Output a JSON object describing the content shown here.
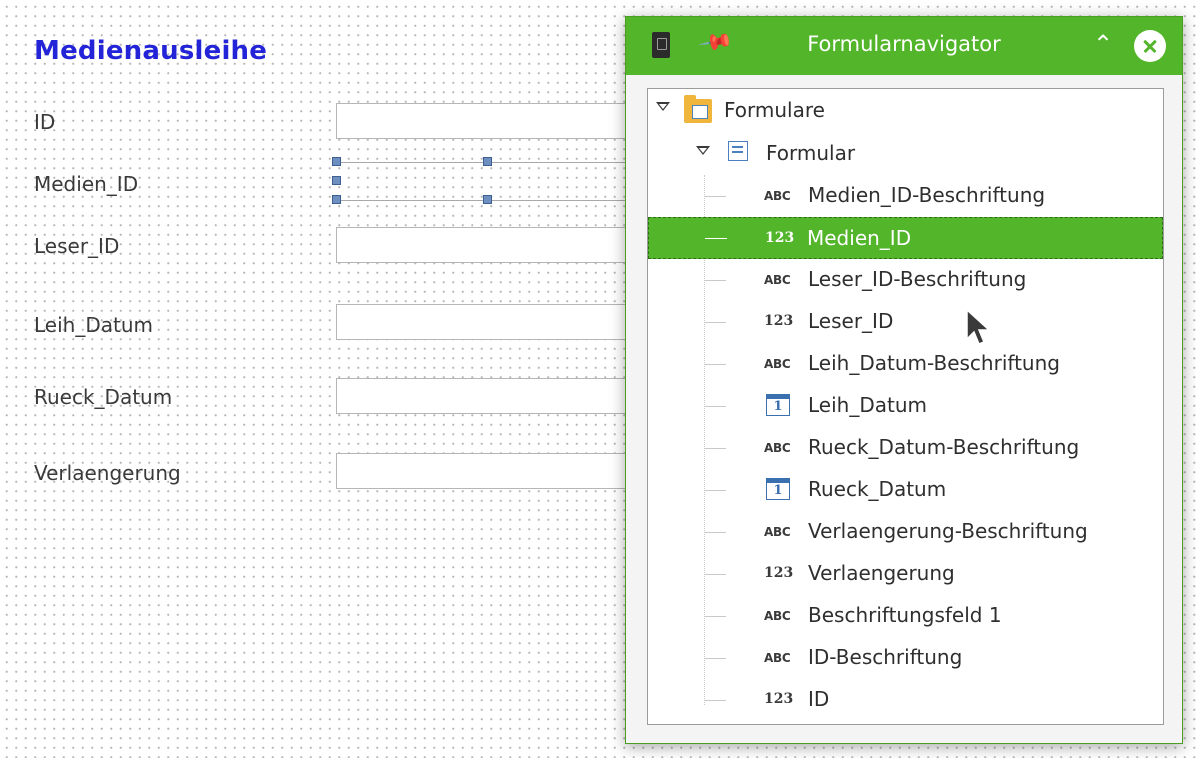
{
  "form": {
    "title": "Medienausleihe",
    "fields": [
      {
        "label": "ID"
      },
      {
        "label": "Medien_ID"
      },
      {
        "label": "Leser_ID"
      },
      {
        "label": "Leih_Datum"
      },
      {
        "label": "Rueck_Datum"
      },
      {
        "label": "Verlaengerung"
      }
    ]
  },
  "navigator": {
    "title": "Formularnavigator",
    "icons": {
      "document": "document-icon",
      "pin": "pin-icon",
      "collapse": "chevron-up-icon",
      "close": "close-icon"
    },
    "tree": {
      "root": {
        "label": "Formulare",
        "icon": "forms-folder-icon",
        "expanded": true
      },
      "form": {
        "label": "Formular",
        "icon": "form-icon",
        "expanded": true
      },
      "items": [
        {
          "label": "Medien_ID-Beschriftung",
          "type": "ABC"
        },
        {
          "label": "Medien_ID",
          "type": "123",
          "selected": true
        },
        {
          "label": "Leser_ID-Beschriftung",
          "type": "ABC"
        },
        {
          "label": "Leser_ID",
          "type": "123"
        },
        {
          "label": "Leih_Datum-Beschriftung",
          "type": "ABC"
        },
        {
          "label": "Leih_Datum",
          "type": "date",
          "date_glyph": "1"
        },
        {
          "label": "Rueck_Datum-Beschriftung",
          "type": "ABC"
        },
        {
          "label": "Rueck_Datum",
          "type": "date",
          "date_glyph": "1"
        },
        {
          "label": "Verlaengerung-Beschriftung",
          "type": "ABC"
        },
        {
          "label": "Verlaengerung",
          "type": "123"
        },
        {
          "label": "Beschriftungsfeld 1",
          "type": "ABC"
        },
        {
          "label": "ID-Beschriftung",
          "type": "ABC"
        },
        {
          "label": "ID",
          "type": "123"
        }
      ]
    }
  },
  "colors": {
    "accent": "#52b52a",
    "form_title": "#2323d8",
    "selection_handle": "#6f8fbf"
  }
}
